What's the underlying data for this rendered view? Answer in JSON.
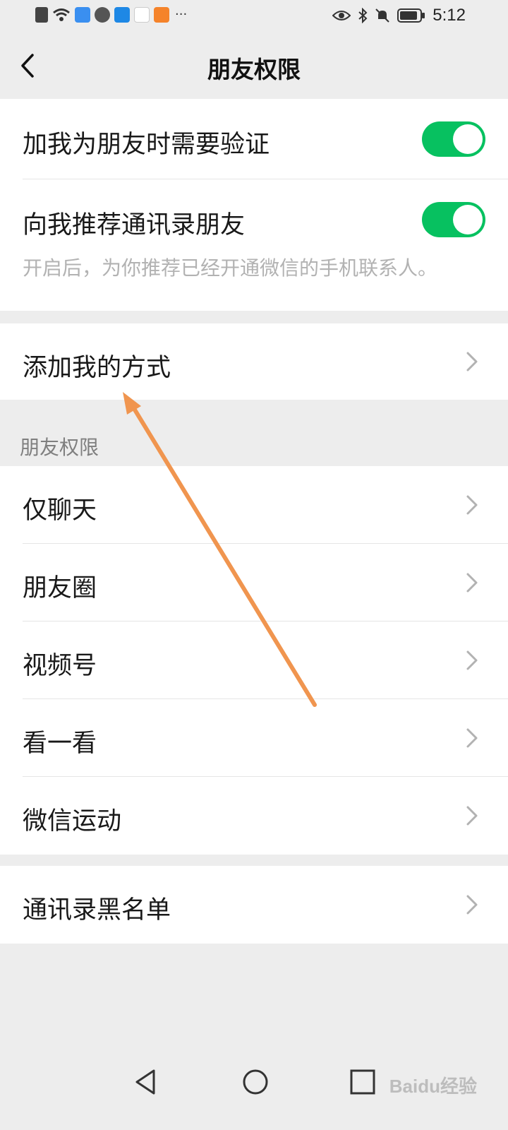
{
  "status_bar": {
    "time": "5:12",
    "more": "···"
  },
  "header": {
    "title": "朋友权限"
  },
  "group1": {
    "items": [
      {
        "label": "加我为朋友时需要验证",
        "toggle_on": true
      },
      {
        "label": "向我推荐通讯录朋友",
        "toggle_on": true,
        "description": "开启后，为你推荐已经开通微信的手机联系人。"
      }
    ]
  },
  "group2": {
    "items": [
      {
        "label": "添加我的方式"
      }
    ]
  },
  "section": {
    "title": "朋友权限"
  },
  "group3": {
    "items": [
      {
        "label": "仅聊天"
      },
      {
        "label": "朋友圈"
      },
      {
        "label": "视频号"
      },
      {
        "label": "看一看"
      },
      {
        "label": "微信运动"
      }
    ]
  },
  "group4": {
    "items": [
      {
        "label": "通讯录黑名单"
      }
    ]
  },
  "watermark": "Baidu经验",
  "colors": {
    "accent": "#07c160",
    "background": "#ededed",
    "annotation_arrow": "#f0954f"
  }
}
